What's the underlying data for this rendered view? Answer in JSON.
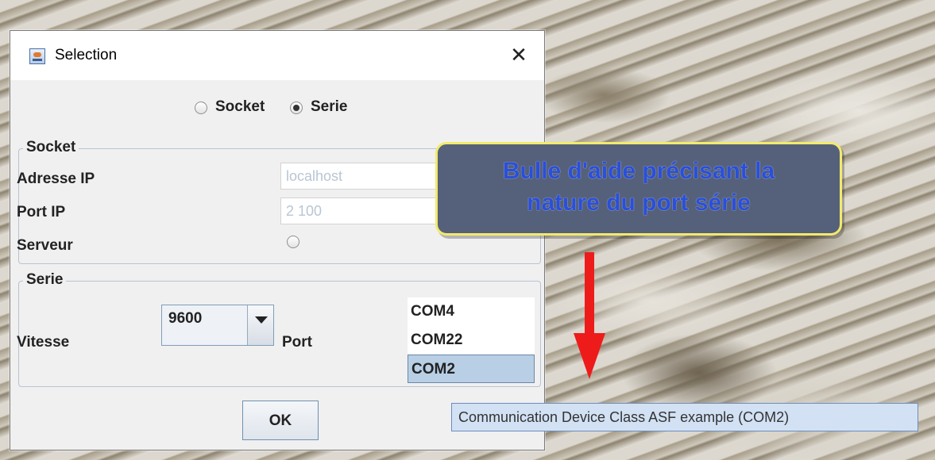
{
  "window": {
    "title": "Selection",
    "close_glyph": "✕",
    "icon": "java-app-icon"
  },
  "mode": {
    "options": [
      "Socket",
      "Serie"
    ],
    "selected": "Serie"
  },
  "socket": {
    "legend": "Socket",
    "ip_label": "Adresse IP",
    "ip_value": "localhost",
    "port_label": "Port IP",
    "port_value": "2 100",
    "server_label": "Serveur",
    "server_checked": false
  },
  "serie": {
    "legend": "Serie",
    "speed_label": "Vitesse",
    "speed_value": "9600",
    "port_label": "Port",
    "ports": [
      "COM4",
      "COM22",
      "COM2"
    ],
    "selected_port": "COM2"
  },
  "buttons": {
    "ok": "OK"
  },
  "callout": {
    "line1": "Bulle d'aide précisant la",
    "line2": "nature du port série",
    "fill": "#55607a",
    "border": "#f1ea6e",
    "text_color": "#2a4fd8"
  },
  "arrow": {
    "color": "#ee1b1b"
  },
  "tooltip": {
    "text": "Communication Device Class ASF example (COM2)"
  }
}
